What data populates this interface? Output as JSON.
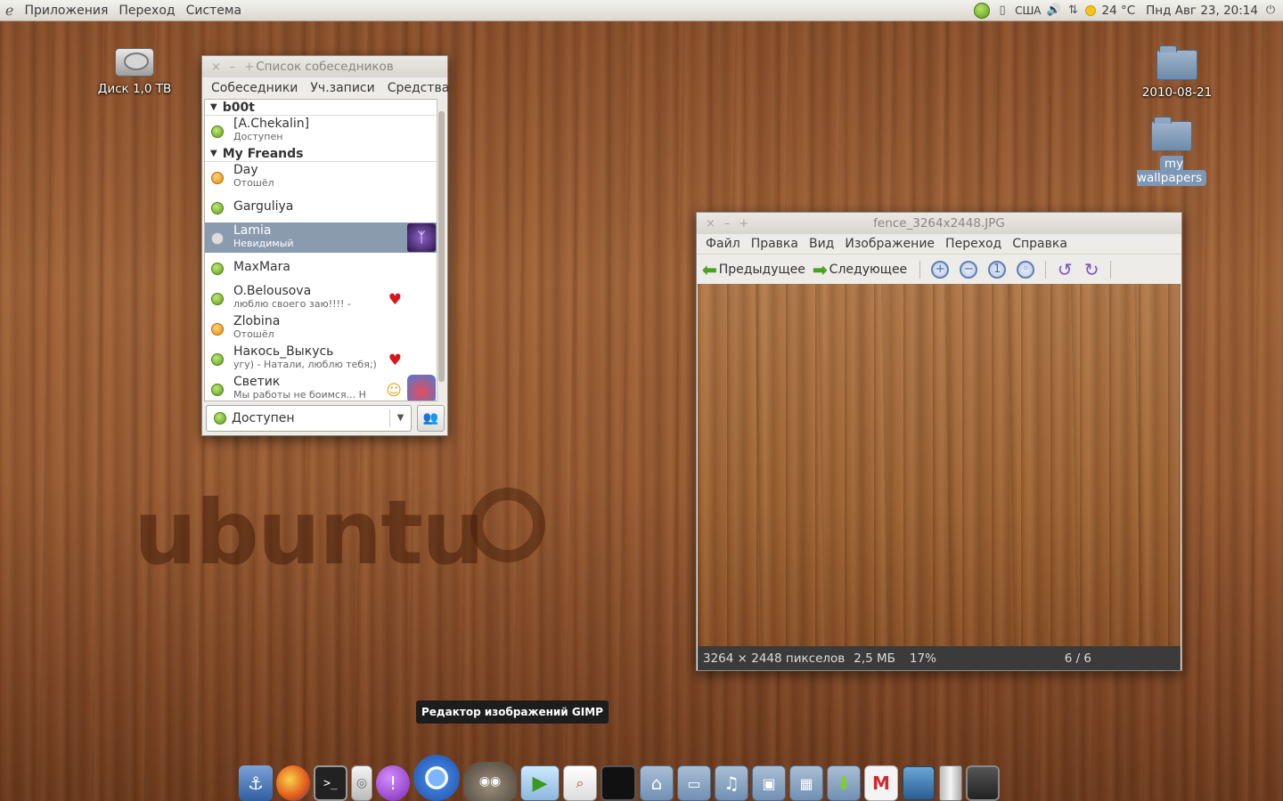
{
  "top_panel": {
    "menus": [
      "Приложения",
      "Переход",
      "Система"
    ],
    "keyboard_layout": "США",
    "weather": "24 °C",
    "datetime": "Пнд Авг 23, 20:14"
  },
  "desktop": {
    "icons": [
      {
        "label": "Диск 1,0 TB",
        "icon": "harddisk-icon"
      },
      {
        "label": "2010-08-21",
        "icon": "folder-icon"
      },
      {
        "label": "my wallpapers",
        "icon": "folder-icon",
        "selected": true
      }
    ],
    "watermark": "ubuntu"
  },
  "buddy_window": {
    "title": "Список собеседников",
    "menu": [
      "Собеседники",
      "Уч.записи",
      "Средства"
    ],
    "groups": [
      {
        "name": "b00t",
        "buddies": [
          {
            "name": "[A.Chekalin]",
            "status_text": "Доступен",
            "status": "available"
          }
        ]
      },
      {
        "name": "My Freands",
        "buddies": [
          {
            "name": "Day",
            "status_text": "Отошёл",
            "status": "away"
          },
          {
            "name": "Garguliya",
            "status_text": "",
            "status": "available"
          },
          {
            "name": "Lamia",
            "status_text": "Невидимый",
            "status": "invisible",
            "selected": true
          },
          {
            "name": "MaxMara",
            "status_text": "",
            "status": "available"
          },
          {
            "name": "O.Belousova",
            "status_text": "люблю своего заю!!!! -",
            "status": "available",
            "emblem": "heart-icon"
          },
          {
            "name": "Zlobina",
            "status_text": "Отошёл",
            "status": "away"
          },
          {
            "name": "Накось_Выкусь",
            "status_text": "угу) - Натали, люблю тебя;)",
            "status": "available",
            "emblem": "heart-icon"
          },
          {
            "name": "Светик",
            "status_text": "Мы работы не боимся... Н",
            "status": "available"
          }
        ]
      }
    ],
    "status_combo": "Доступен"
  },
  "viewer_window": {
    "title": "fence_3264x2448.JPG",
    "menu": [
      "Файл",
      "Правка",
      "Вид",
      "Изображение",
      "Переход",
      "Справка"
    ],
    "toolbar": {
      "prev": "Предыдущее",
      "next": "Следующее"
    },
    "status": {
      "dimensions": "3264 × 2448 пикселов",
      "size": "2,5 МБ",
      "zoom": "17%",
      "position": "6 / 6"
    }
  },
  "tooltip": "Редактор изображений GIMP",
  "dock": [
    "anchor",
    "firefox",
    "terminal",
    "ipod",
    "pidgin",
    "chromium",
    "gimp",
    "video",
    "image-viewer",
    "monitor",
    "home-folder",
    "documents-folder",
    "music-folder",
    "pictures-folder",
    "videos-folder",
    "downloads-folder",
    "gmail",
    "desktop",
    "trash",
    "screenshot"
  ]
}
